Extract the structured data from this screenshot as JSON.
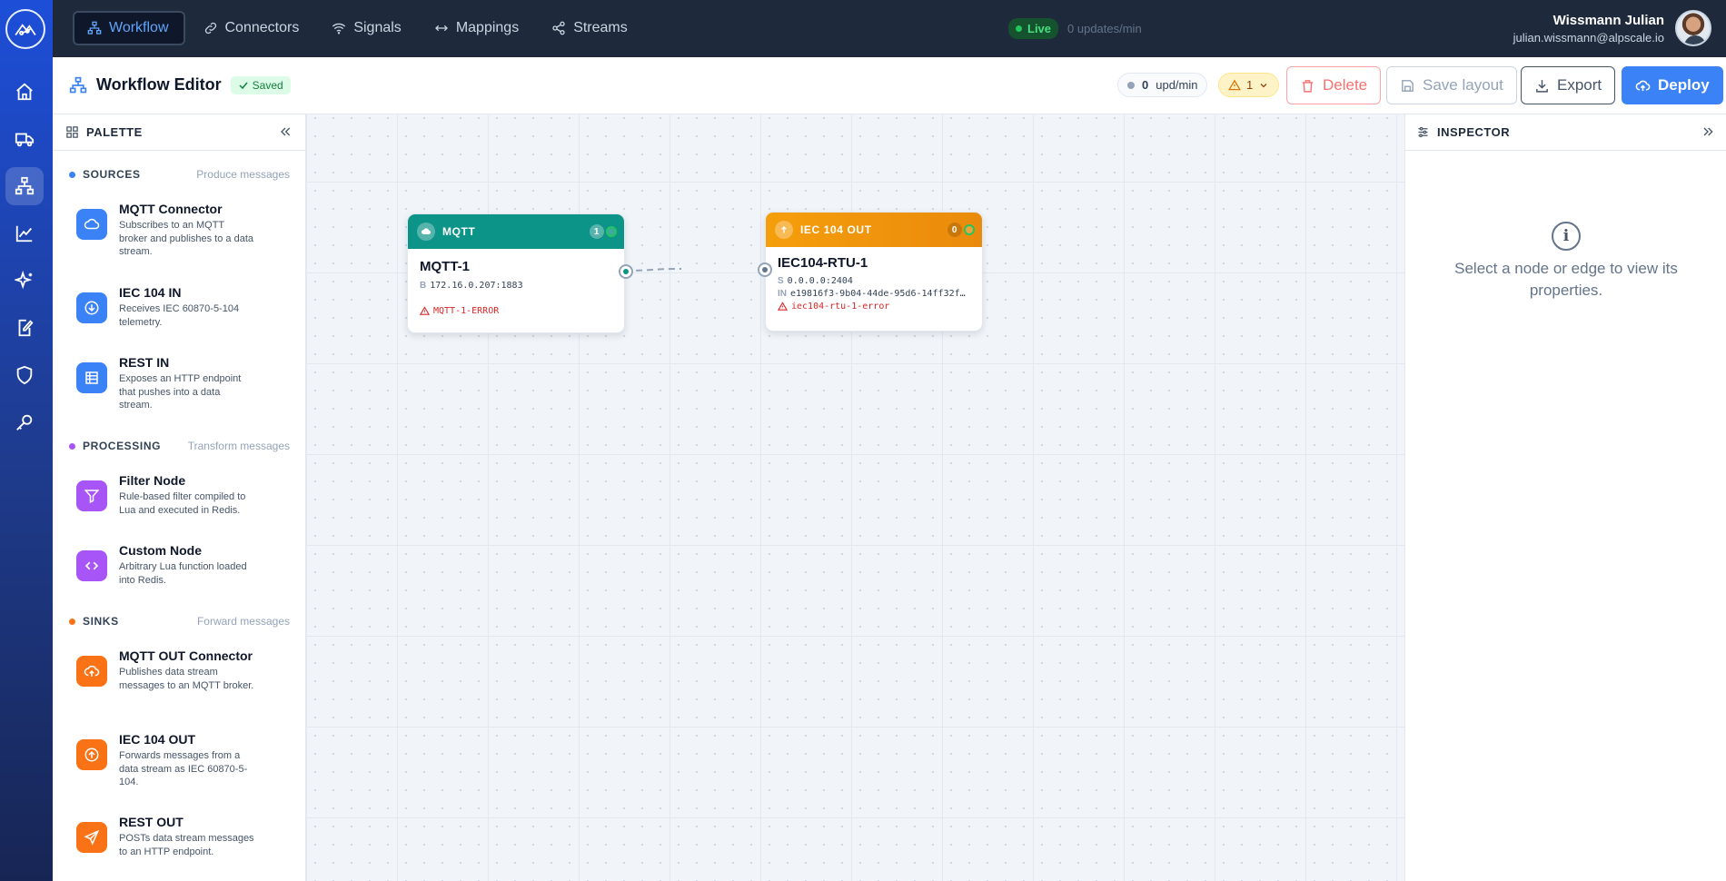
{
  "topbar": {
    "nav": [
      {
        "label": "Workflow",
        "icon": "workflow-icon",
        "active": true
      },
      {
        "label": "Connectors",
        "icon": "link-icon"
      },
      {
        "label": "Signals",
        "icon": "wifi-icon"
      },
      {
        "label": "Mappings",
        "icon": "arrows-horizontal-icon"
      },
      {
        "label": "Streams",
        "icon": "share-icon"
      }
    ],
    "live": {
      "label": "Live",
      "rate": "0 updates/min"
    },
    "user": {
      "name": "Wissmann Julian",
      "email": "julian.wissmann@alpscale.io"
    }
  },
  "sidebar": {
    "items": [
      {
        "icon": "home-icon"
      },
      {
        "icon": "truck-icon"
      },
      {
        "icon": "workflow-icon",
        "active": true
      },
      {
        "icon": "chart-line-icon"
      },
      {
        "icon": "sparkles-icon"
      },
      {
        "icon": "document-edit-icon"
      },
      {
        "icon": "shield-icon"
      },
      {
        "icon": "key-icon"
      }
    ]
  },
  "header": {
    "title": "Workflow Editor",
    "saved_label": "Saved",
    "upd_value": "0",
    "upd_unit": "upd/min",
    "warning_count": "1",
    "delete_label": "Delete",
    "save_layout_label": "Save layout",
    "export_label": "Export",
    "deploy_label": "Deploy"
  },
  "palette": {
    "title": "PALETTE",
    "sections": [
      {
        "title": "SOURCES",
        "subtitle": "Produce messages",
        "color": "#3b82f6"
      },
      {
        "title": "PROCESSING",
        "subtitle": "Transform messages",
        "color": "#a855f7"
      },
      {
        "title": "SINKS",
        "subtitle": "Forward messages",
        "color": "#f97316"
      }
    ],
    "items": [
      {
        "name": "MQTT Connector",
        "desc": "Subscribes to an MQTT broker and publishes to a data stream.",
        "icon": "cloud-icon",
        "color": "#3b82f6"
      },
      {
        "name": "IEC 104 IN",
        "desc": "Receives IEC 60870-5-104 telemetry.",
        "icon": "arrow-down-circle-icon",
        "color": "#3b82f6"
      },
      {
        "name": "REST IN",
        "desc": "Exposes an HTTP endpoint that pushes into a data stream.",
        "icon": "list-icon",
        "color": "#3b82f6"
      },
      {
        "name": "Filter Node",
        "desc": "Rule-based filter compiled to Lua and executed in Redis.",
        "icon": "filter-icon",
        "color": "#a855f7"
      },
      {
        "name": "Custom Node",
        "desc": "Arbitrary Lua function loaded into Redis.",
        "icon": "code-icon",
        "color": "#a855f7"
      },
      {
        "name": "MQTT OUT Connector",
        "desc": "Publishes data stream messages to an MQTT broker.",
        "icon": "cloud-upload-icon",
        "color": "#f97316"
      },
      {
        "name": "IEC 104 OUT",
        "desc": "Forwards messages from a data stream as IEC 60870-5-104.",
        "icon": "arrow-up-circle-icon",
        "color": "#f97316"
      },
      {
        "name": "REST OUT",
        "desc": "POSTs data stream messages to an HTTP endpoint.",
        "icon": "send-icon",
        "color": "#f97316"
      }
    ]
  },
  "canvas": {
    "nodes": [
      {
        "type_label": "MQTT",
        "name": "MQTT-1",
        "count": "1",
        "rows": [
          {
            "key": "B",
            "value": "172.16.0.207:1883"
          }
        ],
        "error": "MQTT-1-ERROR",
        "color": "#0d9488"
      },
      {
        "type_label": "IEC 104 OUT",
        "name": "IEC104-RTU-1",
        "count": "0",
        "rows": [
          {
            "key": "S",
            "value": "0.0.0.0:2404"
          },
          {
            "key": "IN",
            "value": "e19816f3-9b04-44de-95d6-14ff32f…"
          }
        ],
        "error": "iec104-rtu-1-error",
        "color": "#f59e0b"
      }
    ]
  },
  "inspector": {
    "title": "INSPECTOR",
    "empty_text": "Select a node or edge to view its properties."
  }
}
